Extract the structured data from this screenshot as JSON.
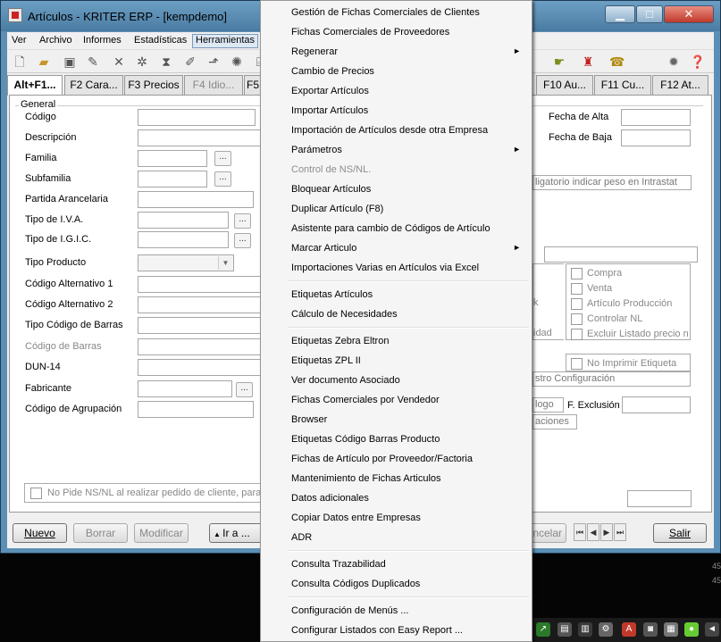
{
  "window": {
    "title": "Artículos - KRITER ERP - [kempdemo]",
    "controls": [
      "minimize",
      "maximize",
      "close"
    ]
  },
  "menubar": [
    "Ver",
    "Archivo",
    "Informes",
    "Estadísticas",
    "Herramientas"
  ],
  "tabs": [
    "Alt+F1...",
    "F2 Cara...",
    "F3 Precios",
    "F4 Idio...",
    "F5",
    "F10 Au...",
    "F11 Cu...",
    "F12 At..."
  ],
  "general": {
    "group_label": "General",
    "fields": {
      "codigo": "Código",
      "descripcion": "Descripción",
      "familia": "Familia",
      "subfamilia": "Subfamilia",
      "partida": "Partida Arancelaria",
      "iva": "Tipo de I.V.A.",
      "igic": "Tipo de I.G.I.C.",
      "producto": "Tipo Producto",
      "alt1": "Código Alternativo 1",
      "alt2": "Código Alternativo 2",
      "tipo_barras": "Tipo Código de Barras",
      "barras": "Código de Barras",
      "dun": "DUN-14",
      "fabricante": "Fabricante",
      "agrupacion": "Código de Agrupación"
    },
    "dots": "...",
    "bottom_check": "No Pide NS/NL al realizar pedido de cliente, para v"
  },
  "right": {
    "fecha_alta": "Fecha de Alta",
    "fecha_baja": "Fecha de Baja",
    "intrastat": "ligatorio indicar peso en Intrastat",
    "checks": [
      "Compra",
      "Venta",
      "Artículo Producción",
      "Controlar NL",
      "Excluir Listado precio n",
      "No Imprimir Etiqueta"
    ],
    "fragments": {
      "k": "k",
      "idad": "idad",
      "config": "stro Configuración",
      "logo": "logo",
      "aciones": "aciones"
    },
    "f_exclusion": "F. Exclusión"
  },
  "buttons": {
    "nuevo": "Nuevo",
    "borrar": "Borrar",
    "modificar": "Modificar",
    "ir": "Ir a ...",
    "cancelar": "ncelar",
    "salir": "Salir"
  },
  "side_numbers": [
    "45",
    "45"
  ],
  "menu": {
    "items": [
      {
        "label": "Gestión de Fichas Comerciales de Clientes"
      },
      {
        "label": "Fichas Comerciales de Proveedores"
      },
      {
        "label": "Regenerar",
        "submenu": true
      },
      {
        "label": "Cambio de Precios"
      },
      {
        "label": "Exportar Artículos"
      },
      {
        "label": "Importar Artículos"
      },
      {
        "label": "Importación de Artículos desde otra Empresa"
      },
      {
        "label": "Parámetros",
        "submenu": true
      },
      {
        "label": "Control de NS/NL.",
        "disabled": true
      },
      {
        "label": "Bloquear Artículos"
      },
      {
        "label": "Duplicar Artículo (F8)"
      },
      {
        "label": "Asistente para cambio de Códigos de Artículo"
      },
      {
        "label": "Marcar Articulo",
        "submenu": true
      },
      {
        "label": "Importaciones Varias en Artículos via Excel"
      },
      {
        "label": "Etiquetas Artículos",
        "sep_before": true
      },
      {
        "label": "Cálculo de Necesidades"
      },
      {
        "label": "Etiquetas Zebra Eltron",
        "sep_before": true
      },
      {
        "label": "Etiquetas ZPL II"
      },
      {
        "label": "Ver documento Asociado"
      },
      {
        "label": "Fichas Comerciales por Vendedor"
      },
      {
        "label": "Browser"
      },
      {
        "label": "Etiquetas Código Barras Producto"
      },
      {
        "label": "Fichas de Artículo por Proveedor/Factoria"
      },
      {
        "label": "Mantenimiento de Fichas Articulos"
      },
      {
        "label": "Datos adicionales"
      },
      {
        "label": "Copiar Datos entre Empresas"
      },
      {
        "label": "ADR"
      },
      {
        "label": "Consulta Trazabilidad",
        "sep_before": true
      },
      {
        "label": "Consulta Códigos Duplicados"
      },
      {
        "label": "Configuración de Menús ...",
        "sep_before": true
      },
      {
        "label": "Configurar Listados con Easy Report ..."
      }
    ],
    "submenu_arrow": "►"
  }
}
